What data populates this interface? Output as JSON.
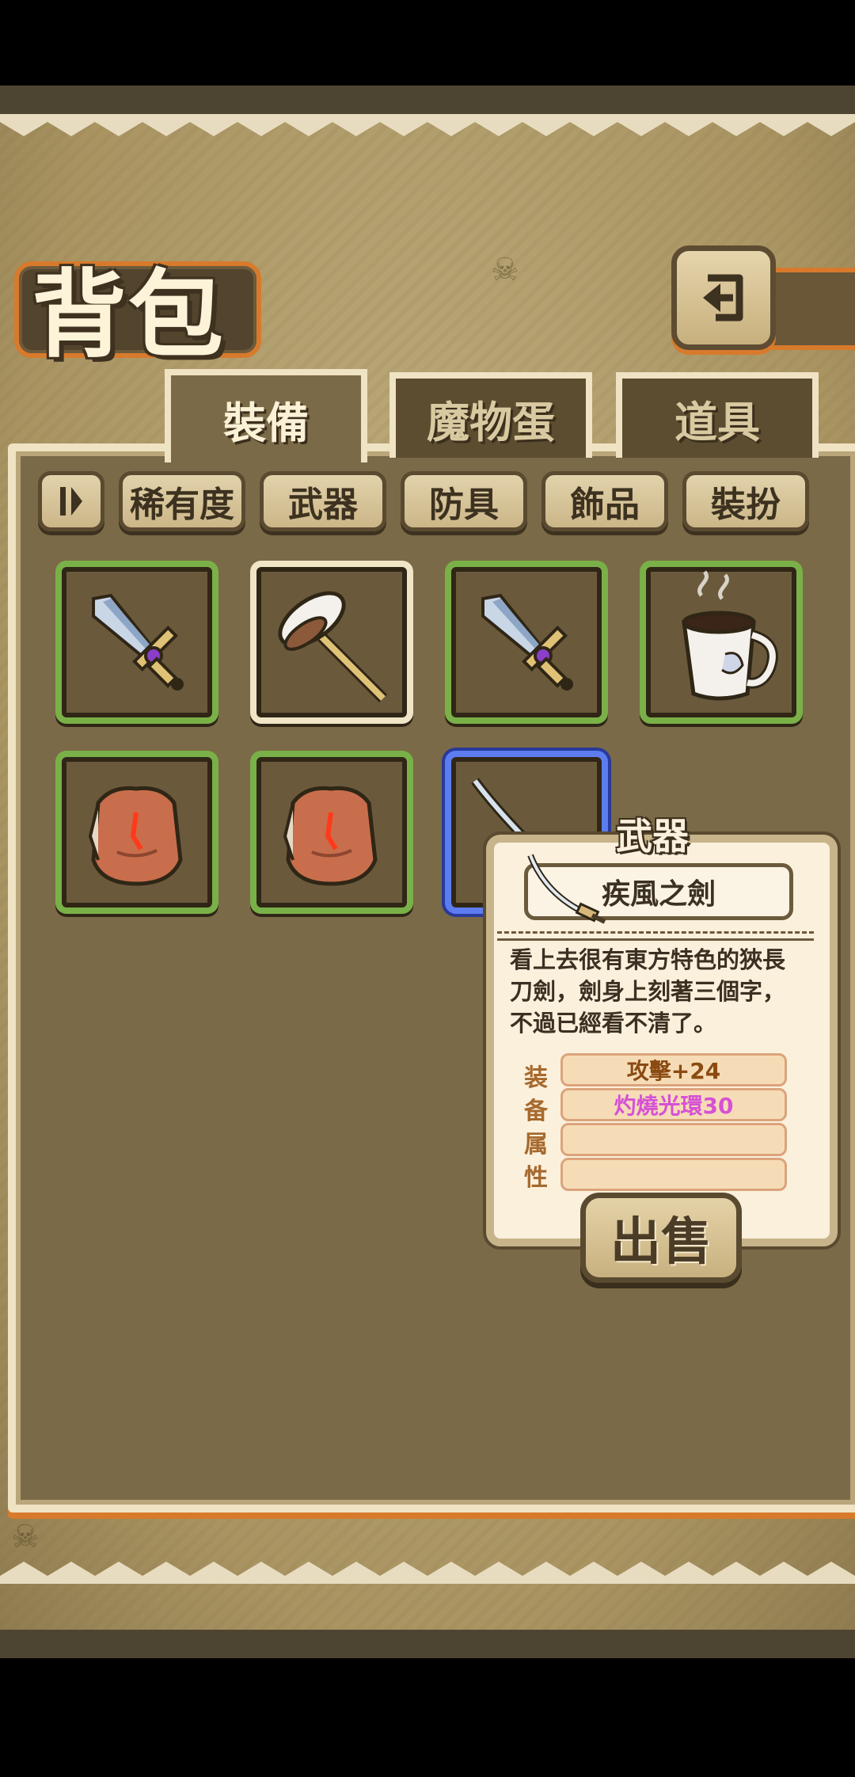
{
  "header": {
    "title": "背包",
    "back_icon": "return-arrow-icon"
  },
  "tabs": [
    {
      "label": "裝備",
      "active": true
    },
    {
      "label": "魔物蛋",
      "active": false
    },
    {
      "label": "道具",
      "active": false
    }
  ],
  "filters": {
    "sort_icon": "sort-toggle-icon",
    "buttons": [
      "稀有度",
      "武器",
      "防具",
      "飾品",
      "裝扮"
    ]
  },
  "items": [
    {
      "name": "sword",
      "icon": "sword-icon",
      "rarity_color": "#7ab048"
    },
    {
      "name": "hammer",
      "icon": "hammer-icon",
      "rarity_color": "#f1e5c7"
    },
    {
      "name": "sword",
      "icon": "sword-icon",
      "rarity_color": "#7ab048"
    },
    {
      "name": "coffee mug",
      "icon": "coffee-mug-icon",
      "rarity_color": "#7ab048"
    },
    {
      "name": "armor",
      "icon": "chest-armor-icon",
      "rarity_color": "#7ab048"
    },
    {
      "name": "armor",
      "icon": "chest-armor-icon",
      "rarity_color": "#7ab048"
    },
    {
      "name": "katana",
      "icon": "katana-icon",
      "rarity_color": "#5c7cf0",
      "selected": true
    }
  ],
  "tooltip": {
    "category": "武器",
    "name": "疾風之劍",
    "description": "看上去很有東方特色的狹長刀劍，劍身上刻著三個字，不過已經看不清了。",
    "attr_label_chars": [
      "装",
      "备",
      "属",
      "性"
    ],
    "attributes": [
      "攻擊+24",
      "灼燒光環30",
      "",
      ""
    ],
    "attribute_colors": [
      "#8a4b12",
      "#d651d6"
    ],
    "sell_label": "出售"
  }
}
